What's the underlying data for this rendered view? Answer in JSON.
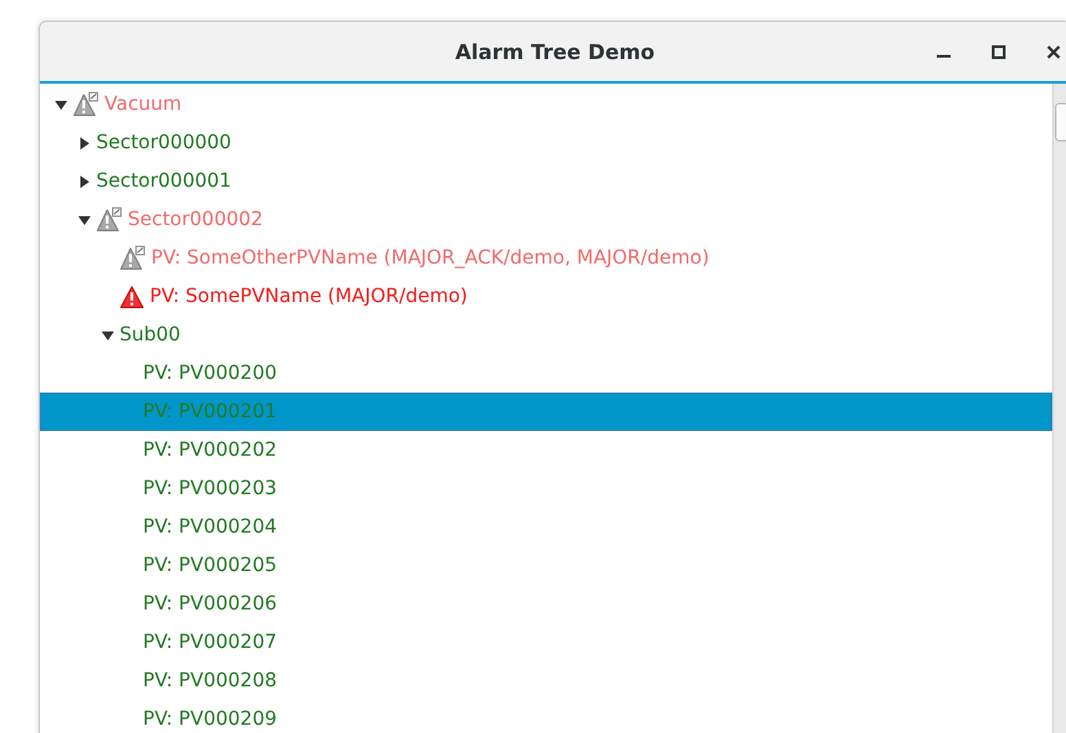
{
  "window": {
    "title": "Alarm Tree Demo"
  },
  "tree": [
    {
      "label": "Vacuum",
      "kind": "acknowledged",
      "expanded": true,
      "selected": false,
      "children": [
        {
          "label": "Sector000000",
          "kind": "normal",
          "expanded": false,
          "selected": false
        },
        {
          "label": "Sector000001",
          "kind": "normal",
          "expanded": false,
          "selected": false
        },
        {
          "label": "Sector000002",
          "kind": "acknowledged",
          "expanded": true,
          "selected": false,
          "children": [
            {
              "label": "PV: SomeOtherPVName (MAJOR_ACK/demo, MAJOR/demo)",
              "kind": "acknowledged",
              "selected": false
            },
            {
              "label": "PV: SomePVName (MAJOR/demo)",
              "kind": "alarm",
              "selected": false
            },
            {
              "label": "Sub00",
              "kind": "normal",
              "expanded": true,
              "selected": false,
              "children": [
                {
                  "label": "PV: PV000200",
                  "kind": "normal",
                  "selected": false
                },
                {
                  "label": "PV: PV000201",
                  "kind": "normal",
                  "selected": true
                },
                {
                  "label": "PV: PV000202",
                  "kind": "normal",
                  "selected": false
                },
                {
                  "label": "PV: PV000203",
                  "kind": "normal",
                  "selected": false
                },
                {
                  "label": "PV: PV000204",
                  "kind": "normal",
                  "selected": false
                },
                {
                  "label": "PV: PV000205",
                  "kind": "normal",
                  "selected": false
                },
                {
                  "label": "PV: PV000206",
                  "kind": "normal",
                  "selected": false
                },
                {
                  "label": "PV: PV000207",
                  "kind": "normal",
                  "selected": false
                },
                {
                  "label": "PV: PV000208",
                  "kind": "normal",
                  "selected": false
                },
                {
                  "label": "PV: PV000209",
                  "kind": "normal",
                  "selected": false
                }
              ]
            }
          ]
        }
      ]
    }
  ]
}
